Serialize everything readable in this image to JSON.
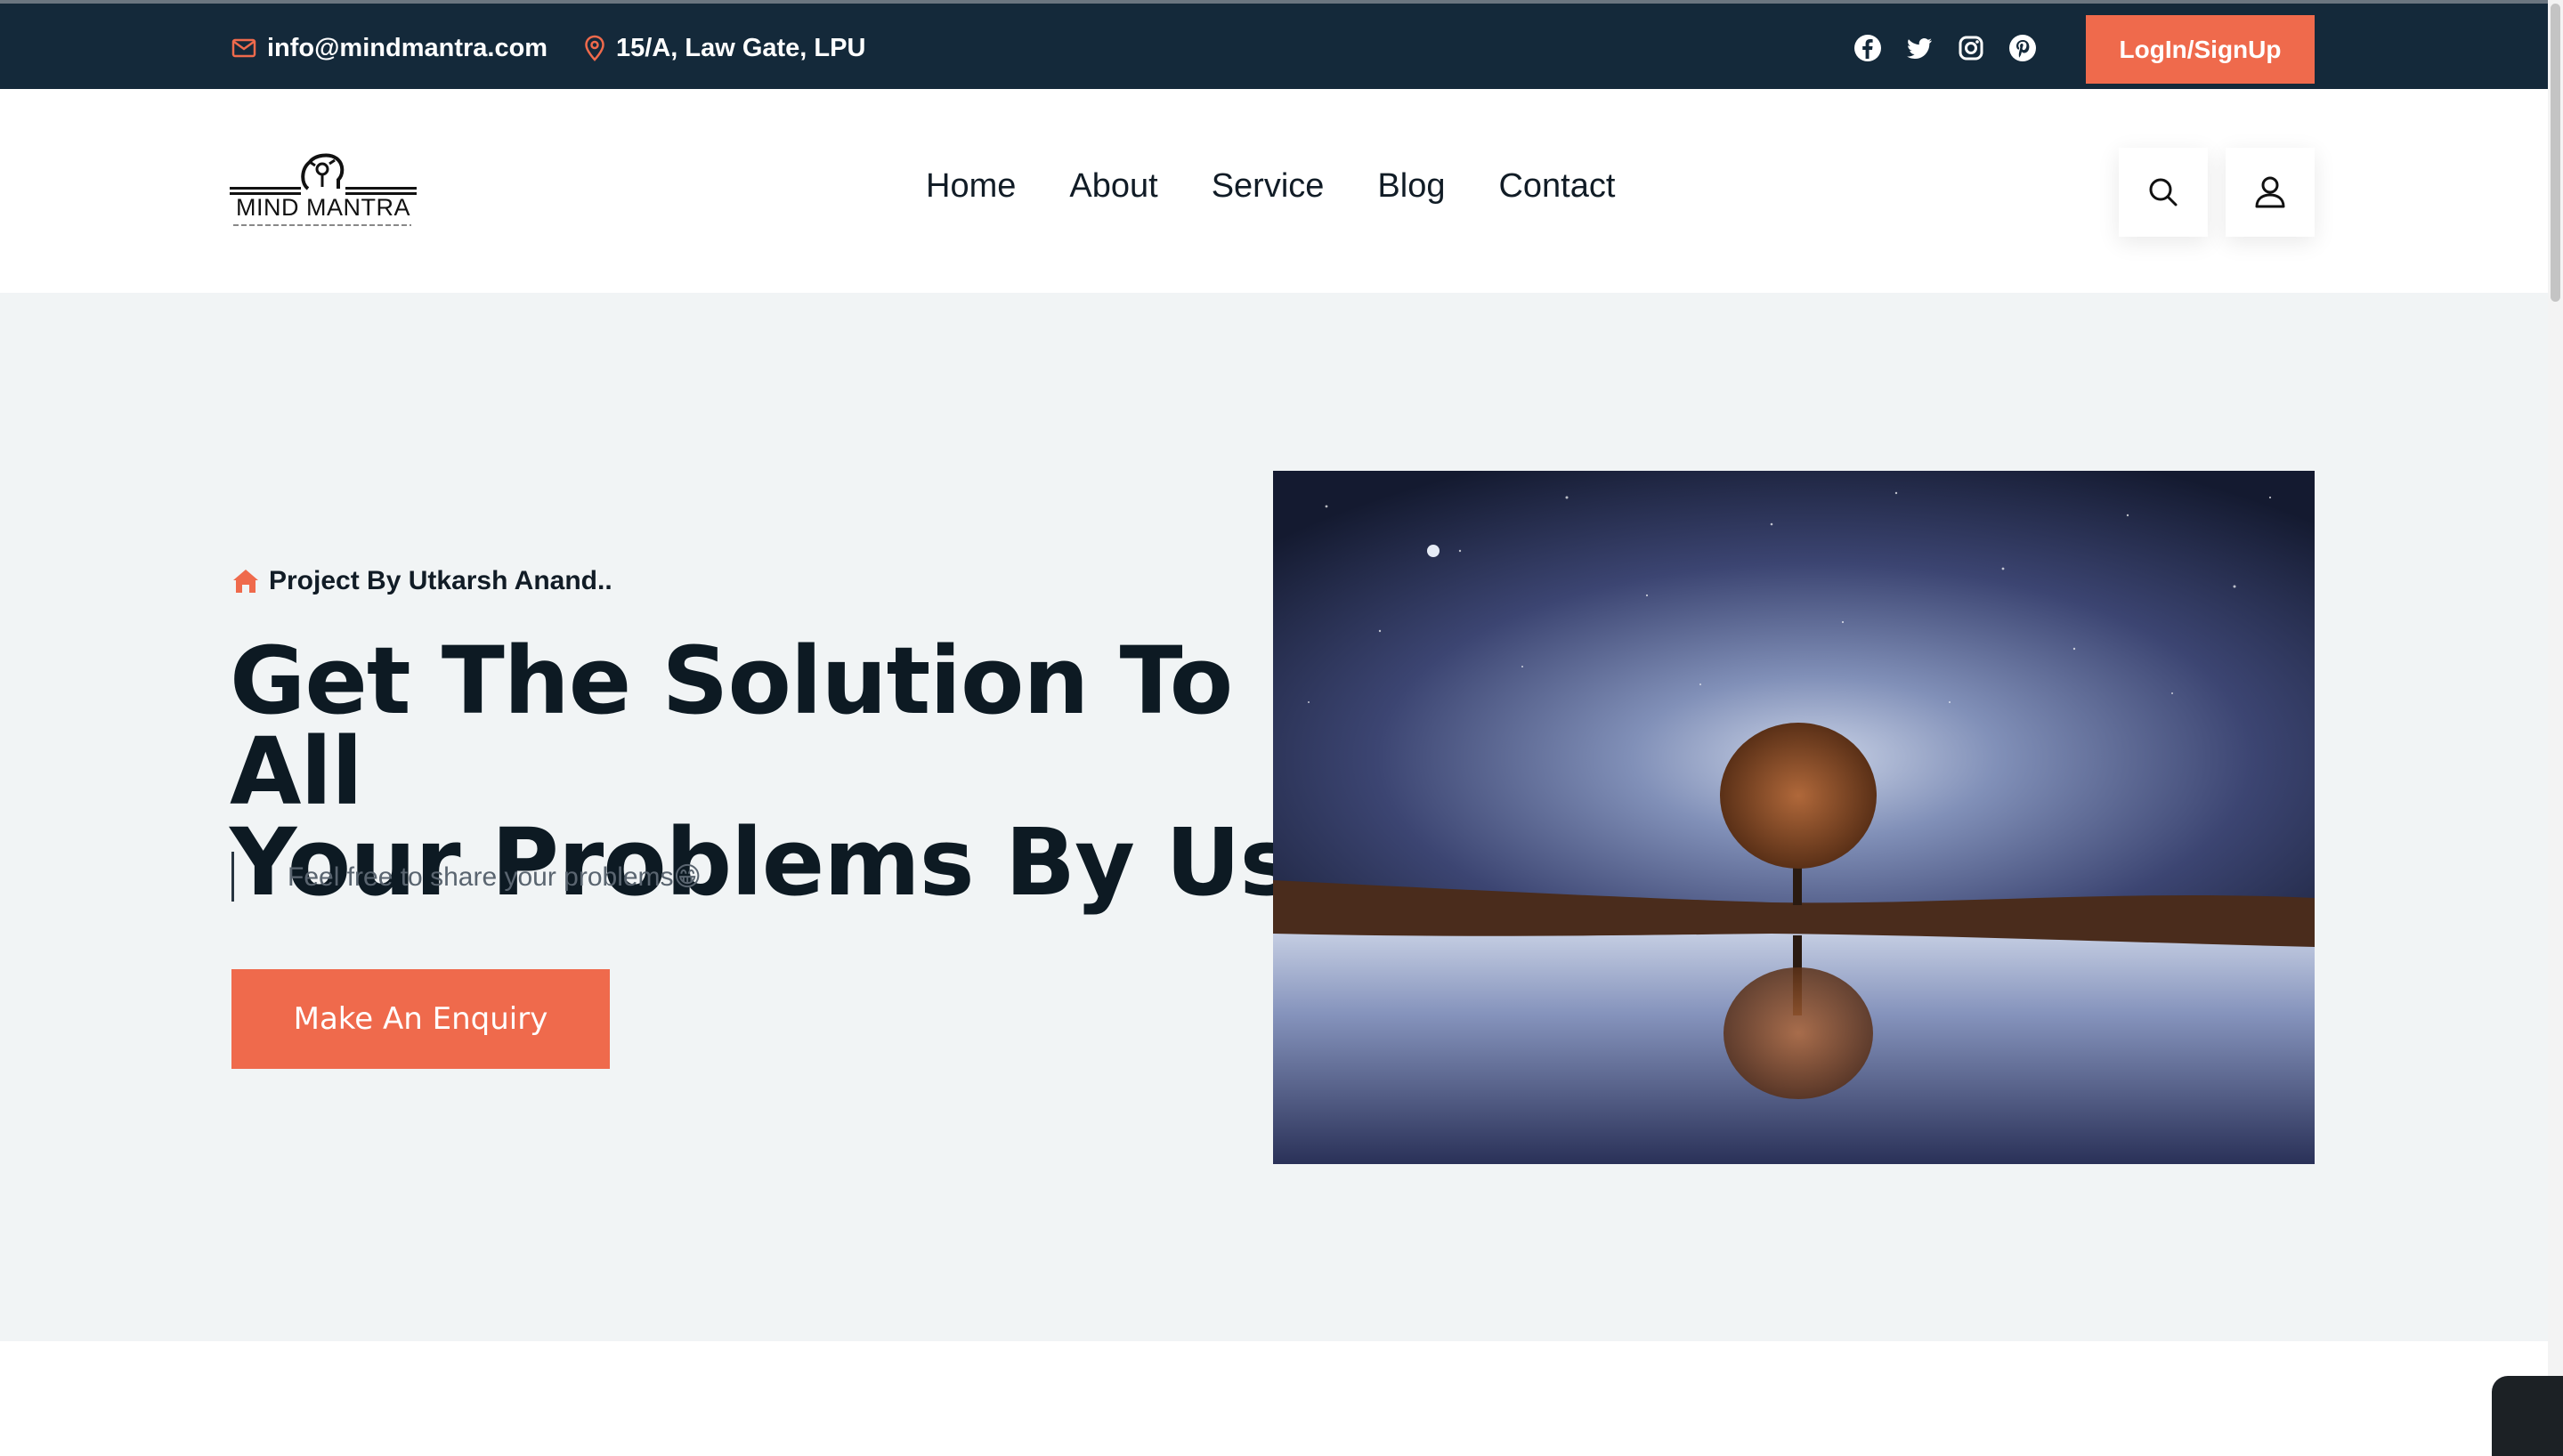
{
  "topbar": {
    "email": "info@mindmantra.com",
    "address": "15/A, Law Gate, LPU",
    "socials": [
      "facebook-icon",
      "twitter-icon",
      "instagram-icon",
      "pinterest-icon"
    ],
    "login_label": "LogIn/SignUp"
  },
  "header": {
    "logo_text": "MIND MANTRA",
    "nav": [
      "Home",
      "About",
      "Service",
      "Blog",
      "Contact"
    ]
  },
  "hero": {
    "tagline": "Project By Utkarsh Anand..",
    "title_line1": "Get The Solution To All",
    "title_line2": "Your Problems By Us",
    "subtitle": "Feel free to share your problems😁",
    "cta_label": "Make An Enquiry"
  },
  "colors": {
    "accent": "#ef6a4c",
    "topbar_bg": "#14293a",
    "hero_bg": "#f1f4f5"
  }
}
